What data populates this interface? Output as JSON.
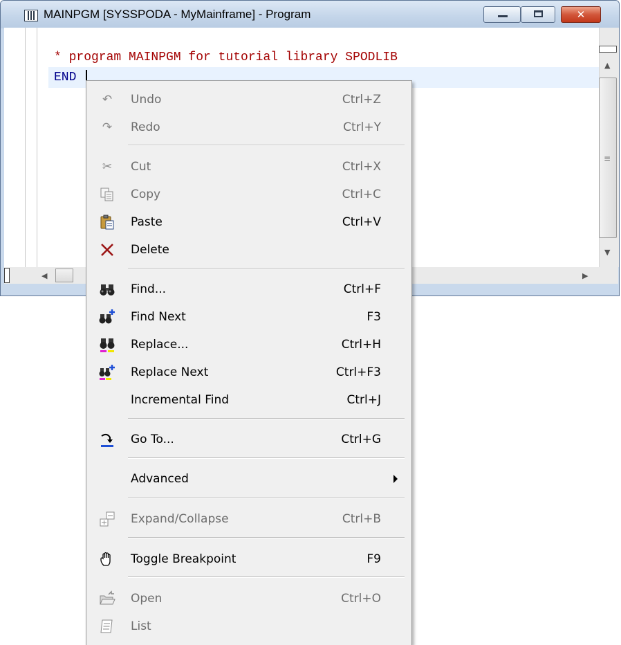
{
  "window": {
    "title": "MAINPGM [SYSSPODA - MyMainframe] - Program",
    "controls": {
      "minimize": "minimize",
      "maximize": "maximize",
      "close": "✕"
    }
  },
  "editor": {
    "lines": [
      "* program MAINPGM for tutorial library SPODLIB",
      "END"
    ],
    "line_colors": [
      "#a30000",
      "#00008b"
    ]
  },
  "context_menu": {
    "items": [
      {
        "id": "undo",
        "label": "Undo",
        "shortcut": "Ctrl+Z",
        "enabled": false,
        "icon": "undo-icon"
      },
      {
        "id": "redo",
        "label": "Redo",
        "shortcut": "Ctrl+Y",
        "enabled": false,
        "icon": "redo-icon"
      },
      {
        "id": "cut",
        "label": "Cut",
        "shortcut": "Ctrl+X",
        "enabled": false,
        "icon": "scissors-icon"
      },
      {
        "id": "copy",
        "label": "Copy",
        "shortcut": "Ctrl+C",
        "enabled": false,
        "icon": "copy-icon"
      },
      {
        "id": "paste",
        "label": "Paste",
        "shortcut": "Ctrl+V",
        "enabled": true,
        "icon": "clipboard-icon"
      },
      {
        "id": "delete",
        "label": "Delete",
        "shortcut": "",
        "enabled": true,
        "icon": "delete-x-icon"
      },
      {
        "id": "find",
        "label": "Find...",
        "shortcut": "Ctrl+F",
        "enabled": true,
        "icon": "binoculars-icon"
      },
      {
        "id": "find-next",
        "label": "Find Next",
        "shortcut": "F3",
        "enabled": true,
        "icon": "binoculars-plus-icon"
      },
      {
        "id": "replace",
        "label": "Replace...",
        "shortcut": "Ctrl+H",
        "enabled": true,
        "icon": "replace-binoculars-icon"
      },
      {
        "id": "replace-next",
        "label": "Replace Next",
        "shortcut": "Ctrl+F3",
        "enabled": true,
        "icon": "replace-next-icon"
      },
      {
        "id": "incremental-find",
        "label": "Incremental Find",
        "shortcut": "Ctrl+J",
        "enabled": true,
        "icon": ""
      },
      {
        "id": "go-to",
        "label": "Go To...",
        "shortcut": "Ctrl+G",
        "enabled": true,
        "icon": "goto-arrow-icon"
      },
      {
        "id": "advanced",
        "label": "Advanced",
        "shortcut": "",
        "enabled": true,
        "icon": "",
        "submenu": true
      },
      {
        "id": "expand-collapse",
        "label": "Expand/Collapse",
        "shortcut": "Ctrl+B",
        "enabled": false,
        "icon": "expand-collapse-icon"
      },
      {
        "id": "toggle-breakpoint",
        "label": "Toggle Breakpoint",
        "shortcut": "F9",
        "enabled": true,
        "icon": "hand-icon"
      },
      {
        "id": "open",
        "label": "Open",
        "shortcut": "Ctrl+O",
        "enabled": false,
        "icon": "open-folder-icon"
      },
      {
        "id": "list",
        "label": "List",
        "shortcut": "",
        "enabled": false,
        "icon": "list-icon"
      }
    ]
  }
}
